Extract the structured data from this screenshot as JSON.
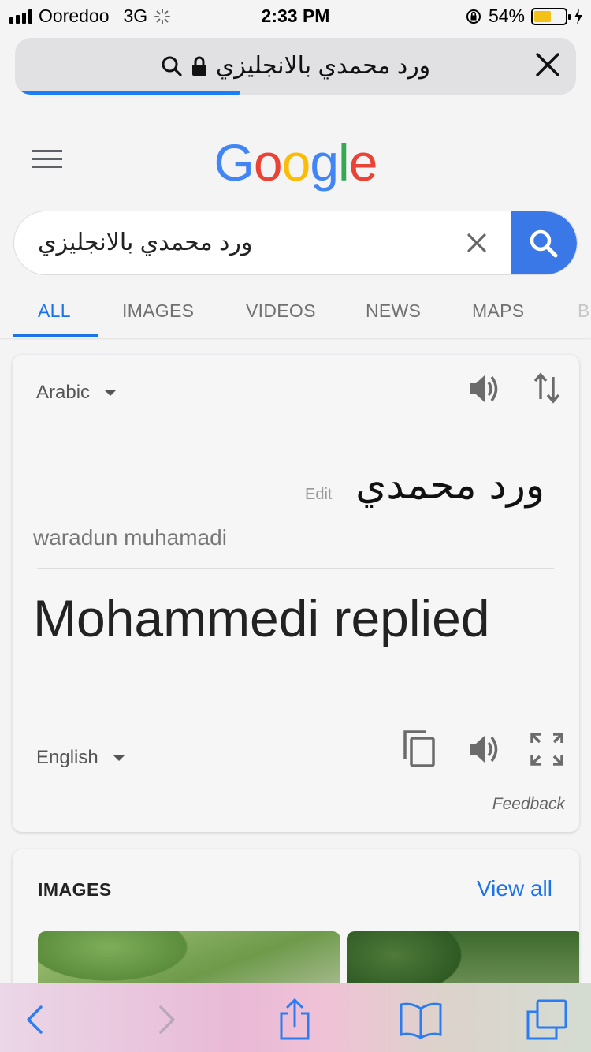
{
  "status_bar": {
    "carrier": "Ooredoo",
    "network": "3G",
    "time": "2:33 PM",
    "battery_percent_label": "54%",
    "battery_level": 0.54
  },
  "address_bar": {
    "query_text": "ورد محمدي بالانجليزي",
    "load_progress": 0.4
  },
  "google": {
    "logo_letters": [
      "G",
      "o",
      "o",
      "g",
      "l",
      "e"
    ],
    "logo_colors": [
      "#4285F4",
      "#EA4335",
      "#FBBC05",
      "#4285F4",
      "#34A853",
      "#EA4335"
    ],
    "search_value": "ورد محمدي بالانجليزي",
    "tabs": [
      {
        "label": "ALL",
        "active": true
      },
      {
        "label": "IMAGES",
        "active": false
      },
      {
        "label": "VIDEOS",
        "active": false
      },
      {
        "label": "NEWS",
        "active": false
      },
      {
        "label": "MAPS",
        "active": false
      },
      {
        "label": "B",
        "active": false
      }
    ]
  },
  "translate": {
    "source_language": "Arabic",
    "edit_label": "Edit",
    "source_text": "ورد محمدي",
    "transliteration": "waradun muhamadi",
    "translation": "Mohammedi replied",
    "target_language": "English",
    "feedback_label": "Feedback"
  },
  "images_section": {
    "title": "IMAGES",
    "view_all_label": "View all"
  },
  "colors": {
    "accent": "#1a73e8",
    "search_button": "#3b78e7",
    "progress": "#1b7ef6",
    "battery": "#f2c21b"
  }
}
